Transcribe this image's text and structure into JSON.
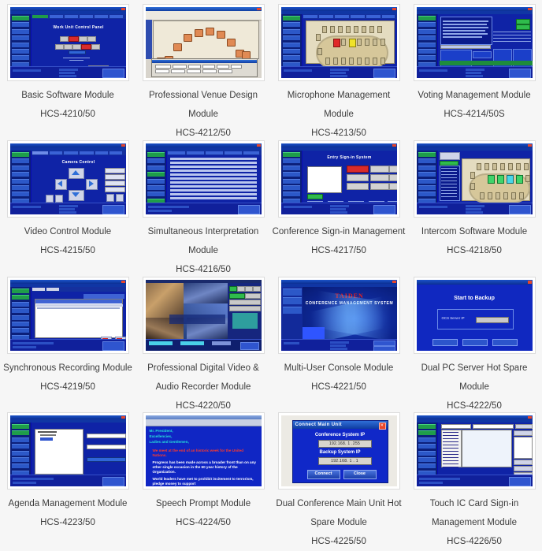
{
  "page": {
    "background": "#f6f6f6",
    "text_color": "#3d3d3d",
    "columns": 4,
    "rows": 4
  },
  "modules": [
    {
      "name": "Basic Software Module",
      "code": "HCS-4210/50",
      "thumb": "basic-software",
      "screen_title": "Work Unit Control Panel"
    },
    {
      "name": "Professional Venue Design Module",
      "code": "HCS-4212/50",
      "thumb": "venue-design",
      "screen_title": ""
    },
    {
      "name": "Microphone Management Module",
      "code": "HCS-4213/50",
      "thumb": "microphone-management",
      "screen_title": ""
    },
    {
      "name": "Voting Management Module",
      "code": "HCS-4214/50S",
      "thumb": "voting-management",
      "screen_title": ""
    },
    {
      "name": "Video Control Module",
      "code": "HCS-4215/50",
      "thumb": "video-control",
      "screen_title": "Camera Control"
    },
    {
      "name": "Simultaneous Interpretation Module",
      "code": "HCS-4216/50",
      "thumb": "simultaneous-interpretation",
      "screen_title": ""
    },
    {
      "name": "Conference Sign-in Management",
      "code": "HCS-4217/50",
      "thumb": "conference-signin",
      "screen_title": "Entry Sign-in System"
    },
    {
      "name": "Intercom Software Module",
      "code": "HCS-4218/50",
      "thumb": "intercom-software",
      "screen_title": ""
    },
    {
      "name": "Synchronous Recording Module",
      "code": "HCS-4219/50",
      "thumb": "synchronous-recording",
      "screen_title": ""
    },
    {
      "name": "Professional Digital Video & Audio Recorder Module",
      "code": "HCS-4220/50",
      "thumb": "digital-video-recorder",
      "screen_title": ""
    },
    {
      "name": "Multi-User Console Module",
      "code": "HCS-4221/50",
      "thumb": "multi-user-console",
      "brand": "TAIDEN",
      "screen_title": "CONFERENCE MANAGEMENT SYSTEM"
    },
    {
      "name": "Dual PC Server Hot Spare Module",
      "code": "HCS-4222/50",
      "thumb": "dual-pc-server",
      "screen_title": "Start to Backup",
      "field_label": "OCS Server IP"
    },
    {
      "name": "Agenda Management Module",
      "code": "HCS-4223/50",
      "thumb": "agenda-management",
      "screen_title": ""
    },
    {
      "name": "Speech Prompt Module",
      "code": "HCS-4224/50",
      "thumb": "speech-prompt",
      "speech_lines": [
        "Mr. President,",
        "Excellencies,",
        "Ladies and Gentlemen,",
        "We meet at the end of an historic week for the United Nations.",
        "Progress has been made across a broader front than on any other single occasion in the 60 year history of the Organization.",
        "World leaders have met to prohibit incitement to terrorism, pledge money to support"
      ]
    },
    {
      "name": "Dual Conference Main Unit Hot Spare Module",
      "code": "HCS-4225/50",
      "thumb": "dual-main-unit",
      "dialog": {
        "title": "Connect Main Unit",
        "label_1": "Conference System IP",
        "value_1": "192.168. 1 .255",
        "label_2": "Backup System IP",
        "value_2": "192.168. 1 . 1",
        "button_connect": "Connect",
        "button_close": "Close",
        "close_icon": "✕"
      }
    },
    {
      "name": "Touch IC Card Sign-in Management Module",
      "code": "HCS-4226/50",
      "thumb": "touch-ic-card",
      "screen_title": ""
    }
  ]
}
